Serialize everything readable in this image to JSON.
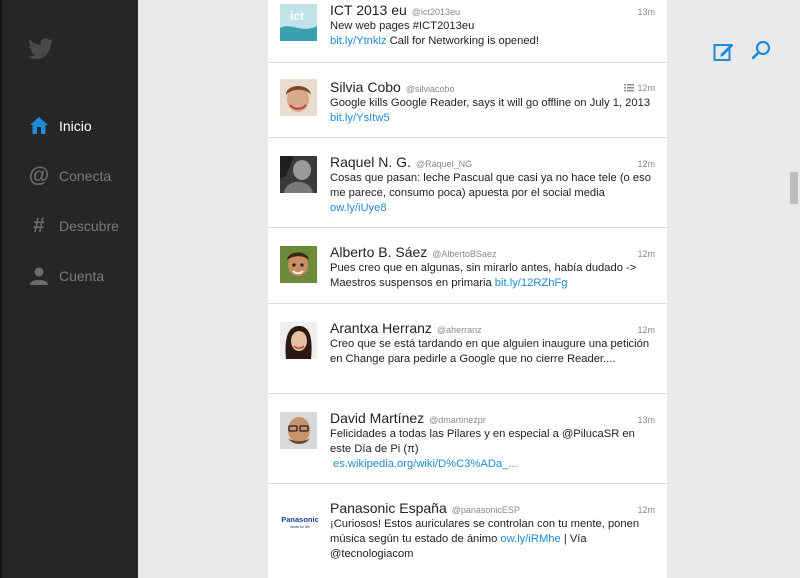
{
  "nav": {
    "items": [
      {
        "label": "Inicio",
        "icon": "home-icon"
      },
      {
        "label": "Conecta",
        "icon": "at-icon"
      },
      {
        "label": "Descubre",
        "icon": "hash-icon"
      },
      {
        "label": "Cuenta",
        "icon": "person-icon"
      }
    ],
    "at_glyph": "@",
    "hash_glyph": "#"
  },
  "colors": {
    "accent": "#1e8bd8",
    "sidebar": "#262626",
    "link": "#1e8bd8"
  },
  "tweets": [
    {
      "name": "ICT 2013 eu",
      "handle": "@ict2013eu",
      "time": "13m",
      "text1": "New web pages #ICT2013eu",
      "link1": "bit.ly/Ytnklz",
      "text2": " Call for Networking is opened!"
    },
    {
      "name": "Silvia Cobo",
      "handle": "@silviacobo",
      "time": "12m",
      "text1": "Google kills Google Reader, says it will go offline on July 1, 2013 ",
      "link1": "bit.ly/YsItw5"
    },
    {
      "name": "Raquel N. G.",
      "handle": "@Raquel_NG",
      "time": "12m",
      "text1": "Cosas que pasan: leche Pascual que casi ya no hace tele (o eso me parece, consumo poca) apuesta por el social media ",
      "link1": "ow.ly/iUye8"
    },
    {
      "name": "Alberto B. Sáez",
      "handle": "@AlbertoBSaez",
      "time": "12m",
      "text1": "Pues creo que en algunas, sin mirarlo antes, había dudado -> Maestros suspensos en primaria ",
      "link1": "bit.ly/12RZhFg"
    },
    {
      "name": "Arantxa Herranz",
      "handle": "@aherranz",
      "time": "12m",
      "text1": "Creo que se está tardando en que alguien inaugure una petición en Change para pedirle a Google que no cierre Reader...."
    },
    {
      "name": "David Martínez",
      "handle": "@dmartinezpr",
      "time": "13m",
      "text1": "Felicidades a todas las Pilares y en especial a @PilucaSR en este Día de Pi (π)",
      "link1": "es.wikipedia.org/wiki/D%C3%ADa_..."
    },
    {
      "name": "Panasonic España",
      "handle": "@panasonicESP",
      "time": "12m",
      "text1": "¡Curiosos! Estos auriculares se controlan con tu mente, ponen música según tu estado de ánimo ",
      "link1": "ow.ly/iRMhe",
      "text2": " | Vía @tecnologiacom",
      "logo_text": "Panasonic",
      "logo_sub": "ideas for life"
    }
  ]
}
